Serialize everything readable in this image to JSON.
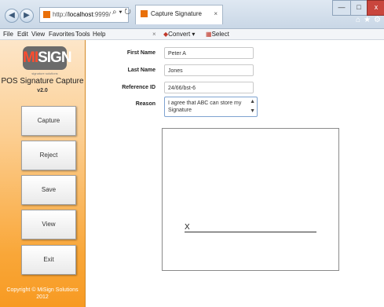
{
  "browser": {
    "address_prefix": "http://",
    "address_host": "localhost",
    "address_rest": ":9999/",
    "search_icon": "⌕ ▾ ↻",
    "tab_title": "Capture Signature",
    "tab_close": "×",
    "win_min": "—",
    "win_max": "□",
    "win_close": "x",
    "home": "⌂",
    "star": "★",
    "gear": "⚙"
  },
  "menu": {
    "file": "File",
    "edit": "Edit",
    "view": "View",
    "favorites": "Favorites",
    "tools": "Tools",
    "help": "Help",
    "close_x": "×",
    "convert": "Convert",
    "convert_arrow": "▾",
    "select": "Select"
  },
  "sidebar": {
    "logo_left": "MI",
    "logo_right": "SIGN",
    "logo_sub": "signature solutions",
    "app_title": "POS Signature Capture",
    "version": "v2.0",
    "buttons": [
      "Capture",
      "Reject",
      "Save",
      "View",
      "Exit"
    ],
    "copyright_line1": "Copyright © MiSign Solutions",
    "copyright_line2": "2012"
  },
  "form": {
    "first_name_label": "First Name",
    "first_name_value": "Peter A",
    "last_name_label": "Last Name",
    "last_name_value": "Jones",
    "reference_label": "Reference ID",
    "reference_value": "24/66/bst-6",
    "reason_label": "Reason",
    "reason_value": "I agree that ABC can store my Signature"
  },
  "signature": {
    "x_mark": "X"
  }
}
